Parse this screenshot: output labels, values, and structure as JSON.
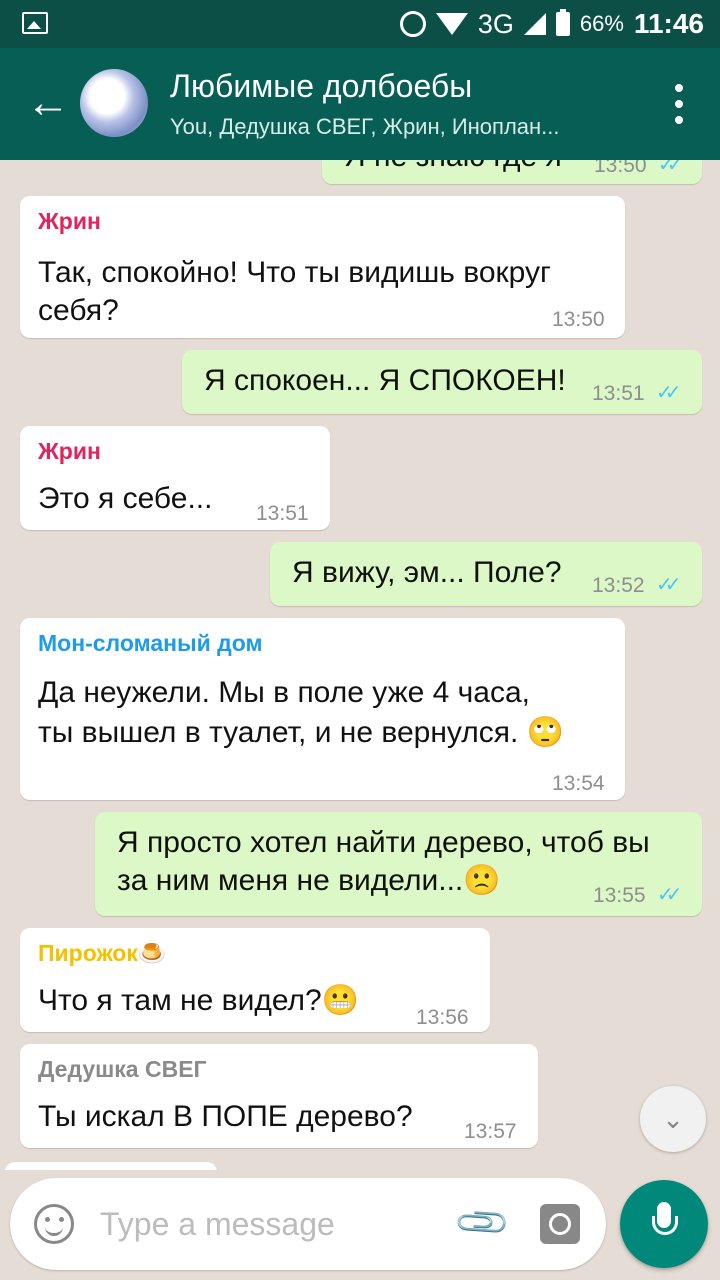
{
  "status_bar": {
    "network": "3G",
    "battery": "66%",
    "time": "11:46"
  },
  "header": {
    "title": "Любимые долбоебы",
    "subtitle": "You, Дедушка СВЕГ, Жрин, Иноплан..."
  },
  "messages": [
    {
      "direction": "out",
      "text": "Я не знаю где я",
      "time": "13:50",
      "read": true
    },
    {
      "direction": "in",
      "sender": "Жрин",
      "sender_color": "#e0245e",
      "text_lines": [
        "Так, спокойно! Что ты видишь вокруг",
        "себя?"
      ],
      "time": "13:50"
    },
    {
      "direction": "out",
      "text": "Я спокоен... Я СПОКОЕН!",
      "time": "13:51",
      "read": true
    },
    {
      "direction": "in",
      "sender": "Жрин",
      "sender_color": "#e0245e",
      "text": "Это я себе...",
      "time": "13:51"
    },
    {
      "direction": "out",
      "text": "Я вижу, эм... Поле?",
      "time": "13:52",
      "read": true
    },
    {
      "direction": "in",
      "sender": "Мон-сломаный дом",
      "sender_color": "#1e9be9",
      "text_lines": [
        "Да неужели. Мы в поле уже 4 часа,",
        "ты вышел в туалет, и не вернулся. 🙄"
      ],
      "time": "13:54"
    },
    {
      "direction": "out",
      "text_lines": [
        "Я просто хотел найти дерево, чтоб вы",
        "за ним меня не видели...🙁"
      ],
      "time": "13:55",
      "read": true
    },
    {
      "direction": "in",
      "sender": "Пирожок🍮",
      "sender_color": "#f2c200",
      "text": "Что я там не видел?😬",
      "time": "13:56"
    },
    {
      "direction": "in",
      "sender": "Дедушка СВЕГ",
      "sender_color": "#8a8a8a",
      "text": "Ты искал В ПОПЕ дерево?",
      "time": "13:57"
    }
  ],
  "input": {
    "placeholder": "Type a message"
  },
  "icons": {
    "back": "arrow-left-icon",
    "menu": "more-vert-icon",
    "emoji": "emoji-icon",
    "attach": "paperclip-icon",
    "camera": "camera-icon",
    "mic": "mic-icon",
    "scroll_down": "chevron-double-down-icon"
  },
  "colors": {
    "header": "#075e54",
    "statusbar": "#0c4f47",
    "outgoing_bubble": "#dcf8c6",
    "incoming_bubble": "#ffffff",
    "chat_bg": "#e5ddd5",
    "accent": "#00897b",
    "read_ticks": "#4fc3f7"
  }
}
